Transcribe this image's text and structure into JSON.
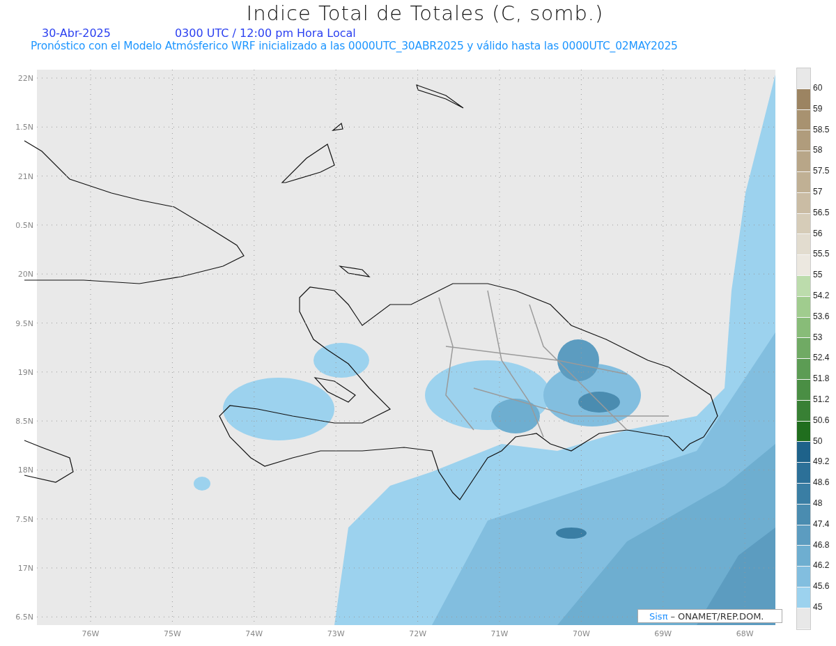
{
  "title": "Indice Total de Totales (C, somb.)",
  "date": "30-Abr-2025",
  "time": "0300 UTC / 12:00 pm Hora Local",
  "subtitle": "Pronóstico con el Modelo Atmósferico WRF inicializado a las 0000UTC_30ABR2025 y válido hasta las  0000UTC_02MAY2025",
  "map": {
    "lat_labels": [
      "22N",
      "1.5N",
      "21N",
      "0.5N",
      "20N",
      "9.5N",
      "19N",
      "8.5N",
      "18N",
      "7.5N",
      "17N",
      "6.5N"
    ],
    "lon_labels": [
      "76W",
      "75W",
      "74W",
      "73W",
      "72W",
      "71W",
      "70W",
      "69W",
      "68W"
    ],
    "credit": {
      "logo": "Sisπ",
      "text": "– ONAMET/REP.DOM."
    }
  },
  "colorbar": {
    "top_band": {
      "color": "#e8e8e8"
    },
    "levels": [
      {
        "label": "60",
        "color": "#9c8462"
      },
      {
        "label": "59",
        "color": "#a89270"
      },
      {
        "label": "58.5",
        "color": "#b09c7c"
      },
      {
        "label": "58",
        "color": "#b8a688"
      },
      {
        "label": "57.5",
        "color": "#c0b094"
      },
      {
        "label": "57",
        "color": "#cabca4"
      },
      {
        "label": "56.5",
        "color": "#d6ccb8"
      },
      {
        "label": "56",
        "color": "#e2dccf"
      },
      {
        "label": "55.5",
        "color": "#ece8e0"
      },
      {
        "label": "55",
        "color": "#bcdcac"
      },
      {
        "label": "54.2",
        "color": "#a0cc8e"
      },
      {
        "label": "53.6",
        "color": "#88bc78"
      },
      {
        "label": "53",
        "color": "#70aa64"
      },
      {
        "label": "52.4",
        "color": "#5c9c54"
      },
      {
        "label": "51.8",
        "color": "#4a8e44"
      },
      {
        "label": "51.2",
        "color": "#388034"
      },
      {
        "label": "50.6",
        "color": "#206e1e"
      },
      {
        "label": "50",
        "color": "#1e628a"
      },
      {
        "label": "49.2",
        "color": "#2c7098"
      },
      {
        "label": "48.6",
        "color": "#3a7ea4"
      },
      {
        "label": "48",
        "color": "#4a8cb0"
      },
      {
        "label": "47.4",
        "color": "#5c9cc0"
      },
      {
        "label": "46.8",
        "color": "#6eaed0"
      },
      {
        "label": "46.2",
        "color": "#82bedf"
      },
      {
        "label": "45.6",
        "color": "#9cd2ee"
      },
      {
        "label": "45",
        "color": "#e8e8e8"
      }
    ]
  }
}
